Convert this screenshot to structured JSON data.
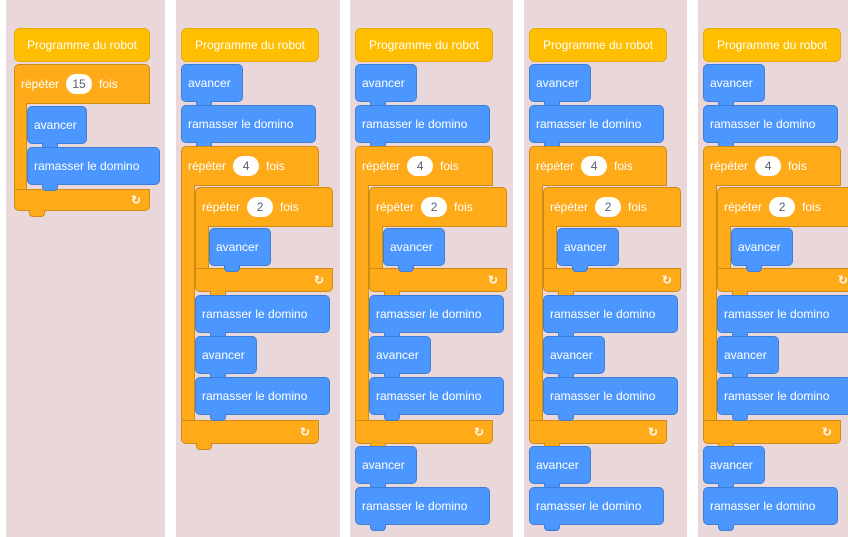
{
  "panels": [
    {
      "hat": "Programme du robot",
      "repeat": "répéter",
      "count": "15",
      "times": "fois",
      "advance": "avancer",
      "pick": "ramasser le domino"
    },
    {
      "hat": "Programme du robot",
      "advance": "avancer",
      "pick": "ramasser le domino",
      "repeat": "répéter",
      "count_outer": "4",
      "times": "fois",
      "count_inner": "2"
    },
    {
      "hat": "Programme du robot",
      "advance": "avancer",
      "pick": "ramasser le domino",
      "repeat": "répéter",
      "count_outer": "4",
      "times": "fois",
      "count_inner": "2"
    },
    {
      "hat": "Programme du robot",
      "advance": "avancer",
      "pick": "ramasser le domino",
      "repeat": "répéter",
      "count_outer": "4",
      "times": "fois",
      "count_inner": "2"
    },
    {
      "hat": "Programme du robot",
      "advance": "avancer",
      "pick": "ramasser le domino",
      "repeat": "répéter",
      "count_outer": "4",
      "times": "fois",
      "count_inner": "2"
    }
  ],
  "icons": {
    "loop": "loop-arrow-icon"
  },
  "colors": {
    "events": "#ffbf00",
    "control": "#ffab19",
    "motion": "#4c97ff",
    "background": "#ead7d9"
  }
}
